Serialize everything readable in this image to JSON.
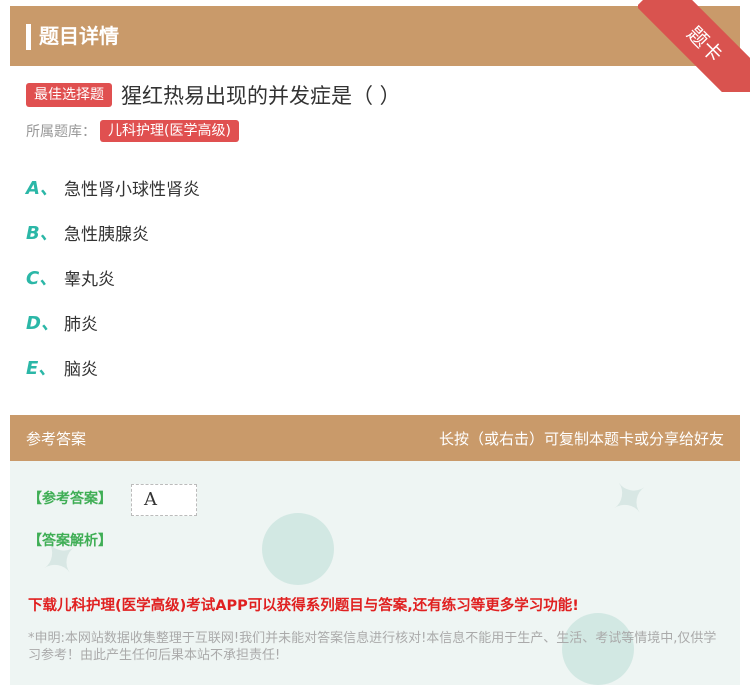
{
  "header": {
    "title": "题目详情",
    "ribbon": "题卡"
  },
  "question": {
    "type_tag": "最佳选择题",
    "text": "猩红热易出现的并发症是（ ）",
    "library_label": "所属题库：",
    "library_name": "儿科护理(医学高级)"
  },
  "options": [
    {
      "letter": "A、",
      "text": "急性肾小球性肾炎"
    },
    {
      "letter": "B、",
      "text": "急性胰腺炎"
    },
    {
      "letter": "C、",
      "text": "睾丸炎"
    },
    {
      "letter": "D、",
      "text": "肺炎"
    },
    {
      "letter": "E、",
      "text": "脑炎"
    }
  ],
  "answer_section": {
    "title": "参考答案",
    "hint": "长按（或右击）可复制本题卡或分享给好友",
    "answer_label": "【参考答案】",
    "answer_value": "A",
    "analysis_label": "【答案解析】",
    "promo": "下载儿科护理(医学高级)考试APP可以获得系列题目与答案,还有练习等更多学习功能!",
    "disclaimer": "*申明:本网站数据收集整理于互联网!我们并未能对答案信息进行核对!本信息不能用于生产、生活、考试等情境中,仅供学习参考！由此产生任何后果本站不承担责任!"
  },
  "colors": {
    "header": "#c99a6a",
    "tag": "#e05050",
    "option_letter": "#2bb7a7",
    "answer_green": "#3fae55",
    "promo_red": "#e02020"
  }
}
